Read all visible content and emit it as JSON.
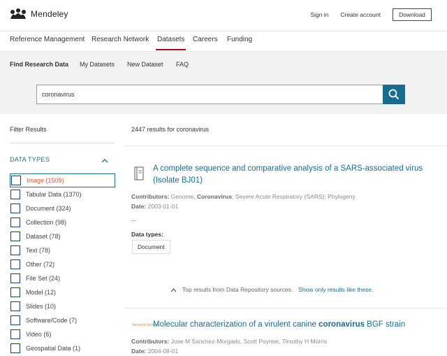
{
  "brand": {
    "name": "Mendeley"
  },
  "top_links": {
    "sign_in": "Sign in",
    "create_account": "Create account",
    "download": "Download"
  },
  "main_nav": [
    {
      "label": "Reference Management"
    },
    {
      "label": "Research Network"
    },
    {
      "label": "Datasets",
      "active": true
    },
    {
      "label": "Careers"
    },
    {
      "label": "Funding"
    }
  ],
  "sub_nav": [
    {
      "label": "Find Research Data",
      "active": true
    },
    {
      "label": "My Datasets"
    },
    {
      "label": "New Dataset"
    },
    {
      "label": "FAQ"
    }
  ],
  "search": {
    "value": "coronavirus",
    "icon": "search-icon"
  },
  "sidebar": {
    "title": "Filter Results",
    "section": "DATA TYPES",
    "filters": [
      {
        "label": "Image (1509)",
        "selected": true
      },
      {
        "label": "Tabular Data (1370)"
      },
      {
        "label": "Document (324)"
      },
      {
        "label": "Collection (98)"
      },
      {
        "label": "Dataset (78)"
      },
      {
        "label": "Text (78)"
      },
      {
        "label": "Other (72)"
      },
      {
        "label": "File Set (24)"
      },
      {
        "label": "Model (12)"
      },
      {
        "label": "Slides (10)"
      },
      {
        "label": "Software/Code (7)"
      },
      {
        "label": "Video (6)"
      },
      {
        "label": "Geospatial Data (1)"
      }
    ]
  },
  "results": {
    "count_text": "2447 results for coronavirus",
    "items": [
      {
        "title": "A complete sequence and comparative analysis of a SARS-associated virus (Isolate BJ01)",
        "contributors_label": "Contributors:",
        "contributors_pre": "Genome; ",
        "contributors_bold": "Coronavirus",
        "contributors_post": "; Severe Acute Respiratory (SARS); Phylogeny",
        "date_label": "Date:",
        "date": "2003-01-01",
        "ellipsis": "...",
        "data_types_label": "Data types:",
        "data_type": "Document"
      },
      {
        "source_logo": "SemanticScholar",
        "title_pre": "Molecular characterization of a virulent canine ",
        "title_bold": "coronavirus",
        "title_post": " BGF strain",
        "contributors_label": "Contributors:",
        "contributors": "Jose M Sanchez-Morgado, Scott Poynter, Timothy H Morris",
        "date_label": "Date:",
        "date": "2004-08-01"
      }
    ],
    "repo_note": "Top results from Data Repository sources.",
    "repo_link": "Show only results like these."
  },
  "colors": {
    "accent": "#1b6c8c",
    "active_underline": "#9a0d0d",
    "selected_filter": "#d05a37"
  }
}
